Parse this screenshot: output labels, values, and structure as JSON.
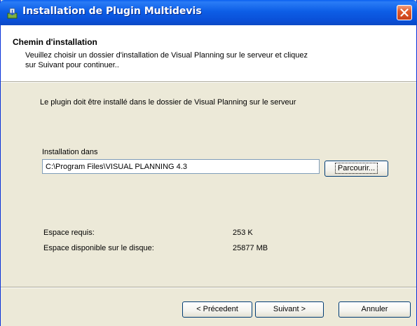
{
  "window": {
    "title": "Installation de Plugin Multidevis"
  },
  "header": {
    "title": "Chemin d'installation",
    "description": "Veuillez choisir un dossier d'installation de Visual Planning sur le serveur et cliquez sur Suivant pour continuer.."
  },
  "body": {
    "intro": "Le plugin doit être installé dans le dossier de Visual Planning sur le serveur",
    "path_label": "Installation dans",
    "path_value": "C:\\Program Files\\VISUAL PLANNING 4.3",
    "browse_label": "Parcourir...",
    "space_required_label": "Espace requis:",
    "space_required_value": "253 K",
    "space_available_label": "Espace disponible sur le disque:",
    "space_available_value": "25877 MB"
  },
  "footer": {
    "prev_label": "< Précedent",
    "next_label": "Suivant >",
    "cancel_label": "Annuler"
  },
  "icons": {
    "app": "installer-icon",
    "close": "close-icon"
  },
  "colors": {
    "titlebar": "#0a50d8",
    "close_button": "#e05a2a",
    "dialog_background": "#ece9d8",
    "header_background": "#ffffff",
    "button_border": "#003c74"
  }
}
